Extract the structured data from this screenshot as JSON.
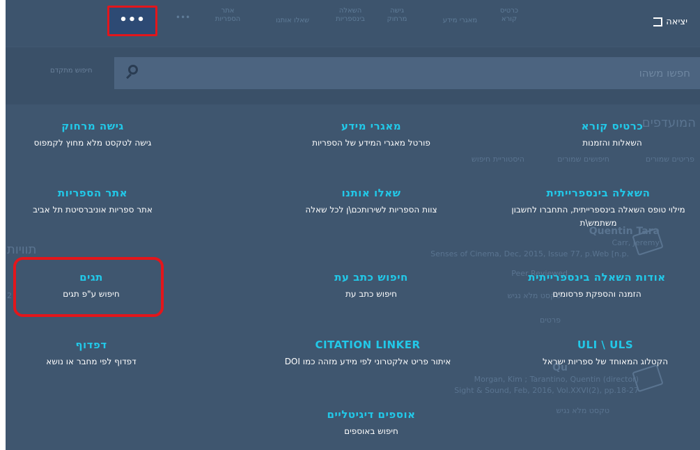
{
  "topbar": {
    "exit_label": "יציאה",
    "more_label": "•••",
    "more_secondary": "•••",
    "nav_items": [
      "כרטיס קורא",
      "מאגרי מידע",
      "גישה מרחוק",
      "השאלה בינספריות",
      "שאלו אותנו",
      "אתר הספריות"
    ]
  },
  "search": {
    "placeholder": "חפשו משהו",
    "advanced_label": "חיפוש מתקדם"
  },
  "background": {
    "heading": "המועדפים",
    "tabs": [
      "פריטים שמורים",
      "חיפושים שמורים",
      "היסטוריית חיפוש"
    ],
    "side_heading": "תוויות",
    "result1": {
      "title": "Quentin Tara",
      "author": "Carr, Jeremy",
      "source": "Senses of Cinema, Dec, 2015, Issue 77, p.Web [n.p.",
      "type": "Peer Reviewed",
      "fulltext": "טקסט מלא נגיש",
      "actions": "פרטים"
    },
    "result2": {
      "title": "Qu",
      "author": "Morgan, Kim ; Tarantino, Quentin (director)",
      "source": "Sight & Sound, Feb, 2016, Vol.XXVI(2), pp.18-27",
      "fulltext": "טקסט מלא נגיש"
    },
    "side_count": "2"
  },
  "menu": [
    {
      "title": "כרטיס קורא",
      "desc": "השאלות והזמנות"
    },
    {
      "title": "מאגרי מידע",
      "desc": "פורטל מאגרי המידע של הספריות"
    },
    {
      "title": "גישה מרחוק",
      "desc": "גישה לטקסט מלא מחוץ לקמפוס"
    },
    {
      "title": "השאלה בינספרייתית",
      "desc": "מילוי טופס השאלה בינספרייתית, התחברו לחשבון משתמש\\ת"
    },
    {
      "title": "שאלו אותנו",
      "desc": "צוות הספריות לשירותכם\\ן לכל שאלה"
    },
    {
      "title": "אתר הספריות",
      "desc": "אתר ספריות אוניברסיטת תל אביב"
    },
    {
      "title": "אודות השאלה בינספרייתית",
      "desc": "הזמנה והספקת פרסומים"
    },
    {
      "title": "חיפוש כתב עת",
      "desc": "חיפוש כתב עת"
    },
    {
      "title": "תגים",
      "desc": "חיפוש ע\"פ תגים"
    },
    {
      "title": "ULI \\ ULS",
      "desc": "הקטלוג המאוחד של ספריות ישראל"
    },
    {
      "title": "CITATION LINKER",
      "desc": "איתור פריט אלקטרוני לפי מידע מזהה כמו DOI"
    },
    {
      "title": "דפדוף",
      "desc": "דפדוף לפי מחבר או נושא"
    },
    {
      "title": "אוספים דיגיטליים",
      "desc": "חיפוש באוספים"
    }
  ],
  "colors": {
    "overlay": "#3f566f",
    "title_accent": "#22c8e8",
    "highlight": "#e3161b"
  }
}
